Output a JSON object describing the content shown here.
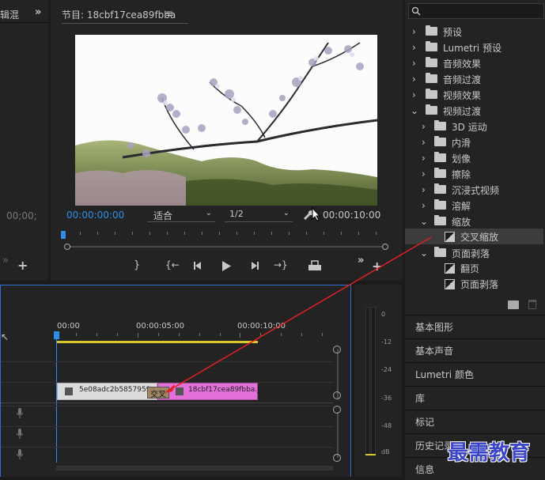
{
  "left_panel": {
    "title": "辑混",
    "timecode": "00;00;"
  },
  "program_monitor": {
    "title": "节目: 18cbf17cea89fbba",
    "current_time": "00:00:00:00",
    "fit_label": "适合",
    "resolution": "1/2",
    "end_time": "00:00:10:00"
  },
  "effects_panel": {
    "search_placeholder": "",
    "items": [
      {
        "label": "预设"
      },
      {
        "label": "Lumetri 预设"
      },
      {
        "label": "音频效果"
      },
      {
        "label": "音频过渡"
      },
      {
        "label": "视频效果"
      },
      {
        "label": "视频过渡"
      },
      {
        "label": "3D 运动"
      },
      {
        "label": "内滑"
      },
      {
        "label": "划像"
      },
      {
        "label": "擦除"
      },
      {
        "label": "沉浸式视频"
      },
      {
        "label": "溶解"
      },
      {
        "label": "缩放"
      },
      {
        "label": "交叉缩放"
      },
      {
        "label": "页面剥落"
      },
      {
        "label": "翻页"
      },
      {
        "label": "页面剥落"
      }
    ]
  },
  "side_panels": [
    "基本图形",
    "基本声音",
    "Lumetri 颜色",
    "库",
    "标记",
    "历史记录",
    "信息"
  ],
  "timeline": {
    "ruler": [
      "00:00",
      "00:00:05:00",
      "00:00:10:00"
    ],
    "clip1": "5e08adc2b5857959",
    "clip2": "18cbf17cea89fbba.jp",
    "transition_label": "交叉"
  },
  "audio_meter": {
    "labels": [
      "0",
      "-12",
      "-24",
      "-36",
      "-48",
      "dB"
    ]
  },
  "watermark": "最需教育"
}
